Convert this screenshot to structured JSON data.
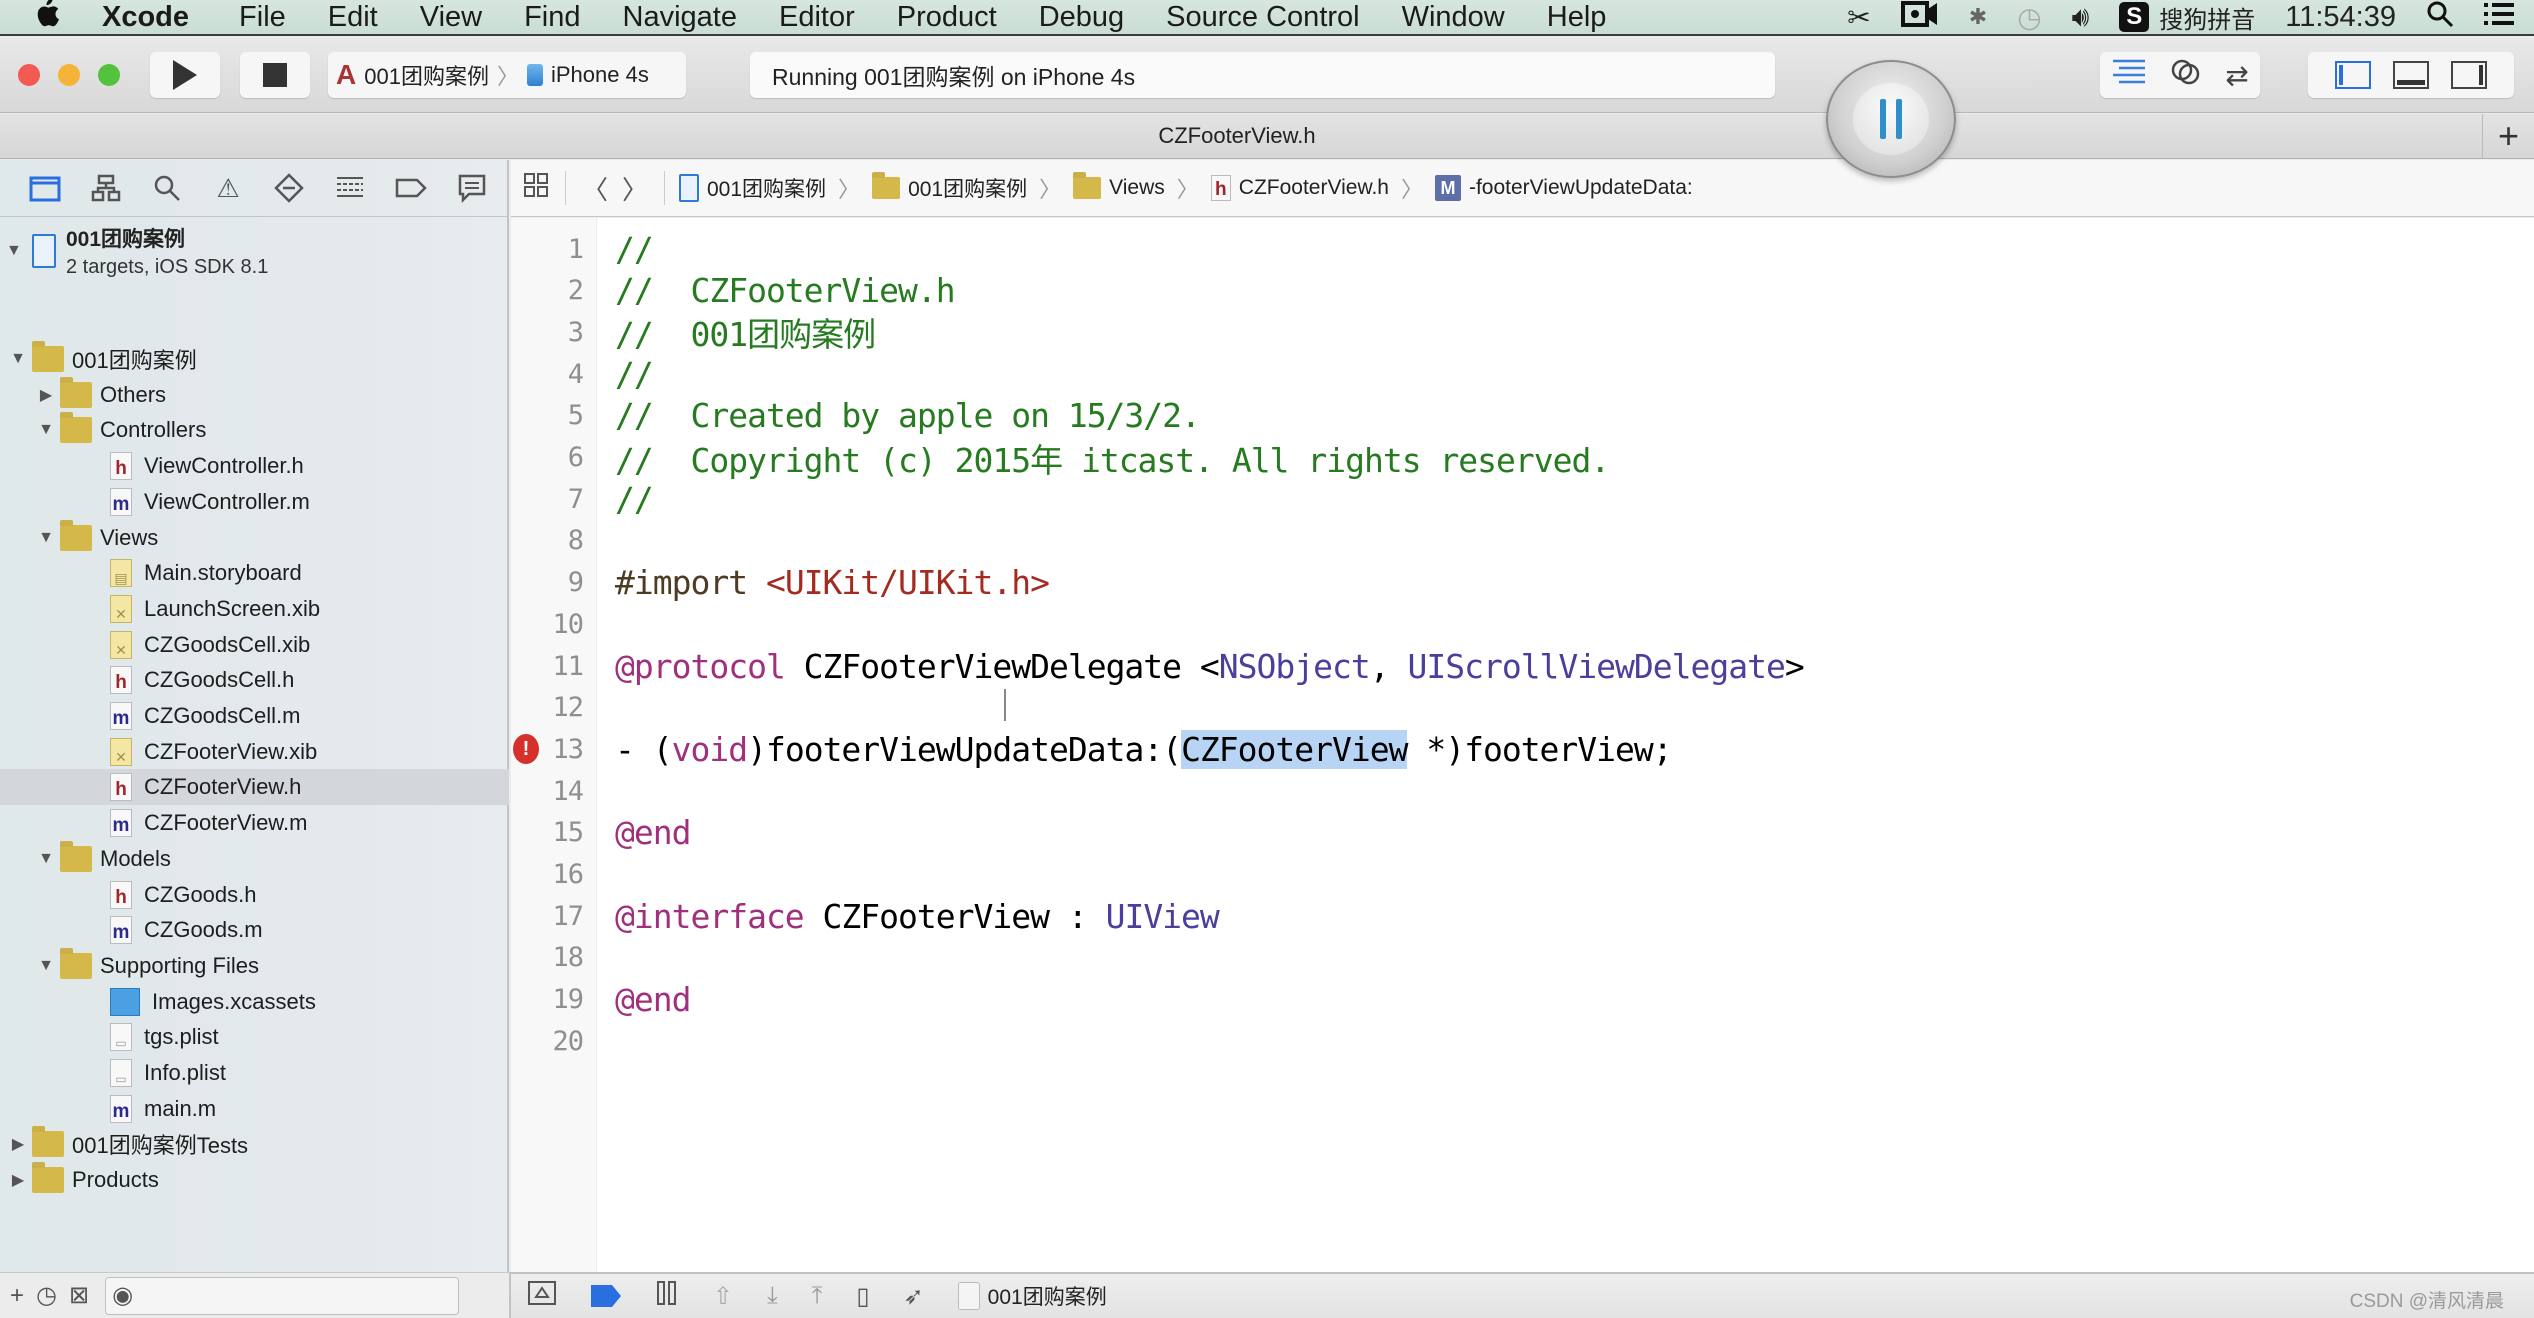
{
  "menubar": {
    "apple_icon": "apple-logo",
    "items": [
      "Xcode",
      "File",
      "Edit",
      "View",
      "Find",
      "Navigate",
      "Editor",
      "Product",
      "Debug",
      "Source Control",
      "Window",
      "Help"
    ],
    "status_icons": [
      "scissors-icon",
      "camera-icon",
      "bluetooth-icon",
      "time-machine-icon",
      "volume-icon"
    ],
    "input_method_badge": "S",
    "input_method_label": "搜狗拼音",
    "clock": "11:54:39",
    "spotlight_icon": "search-icon",
    "notifications_icon": "list-icon"
  },
  "toolbar": {
    "scheme": "001团购案例",
    "device": "iPhone 4s",
    "activity": "Running 001团购案例 on iPhone 4s"
  },
  "tabbar": {
    "title": "CZFooterView.h",
    "add_label": "+"
  },
  "navigator": {
    "tabs": [
      "project",
      "symbol",
      "find",
      "issue",
      "test",
      "debug",
      "breakpoint",
      "report"
    ],
    "project": {
      "name": "001团购案例",
      "subtitle": "2 targets, iOS SDK 8.1"
    },
    "tree": [
      {
        "label": "001团购案例",
        "type": "folder",
        "depth": 1,
        "disclosure": "open"
      },
      {
        "label": "Others",
        "type": "folder",
        "depth": 2,
        "disclosure": "closed"
      },
      {
        "label": "Controllers",
        "type": "folder",
        "depth": 2,
        "disclosure": "open"
      },
      {
        "label": "ViewController.h",
        "type": "h",
        "depth": 3
      },
      {
        "label": "ViewController.m",
        "type": "m",
        "depth": 3
      },
      {
        "label": "Views",
        "type": "folder",
        "depth": 2,
        "disclosure": "open"
      },
      {
        "label": "Main.storyboard",
        "type": "storyboard",
        "depth": 3
      },
      {
        "label": "LaunchScreen.xib",
        "type": "xib",
        "depth": 3
      },
      {
        "label": "CZGoodsCell.xib",
        "type": "xib",
        "depth": 3
      },
      {
        "label": "CZGoodsCell.h",
        "type": "h",
        "depth": 3
      },
      {
        "label": "CZGoodsCell.m",
        "type": "m",
        "depth": 3
      },
      {
        "label": "CZFooterView.xib",
        "type": "xib",
        "depth": 3
      },
      {
        "label": "CZFooterView.h",
        "type": "h",
        "depth": 3,
        "selected": true
      },
      {
        "label": "CZFooterView.m",
        "type": "m",
        "depth": 3
      },
      {
        "label": "Models",
        "type": "folder",
        "depth": 2,
        "disclosure": "open"
      },
      {
        "label": "CZGoods.h",
        "type": "h",
        "depth": 3
      },
      {
        "label": "CZGoods.m",
        "type": "m",
        "depth": 3
      },
      {
        "label": "Supporting Files",
        "type": "folder",
        "depth": 2,
        "disclosure": "open"
      },
      {
        "label": "Images.xcassets",
        "type": "xcassets",
        "depth": 3
      },
      {
        "label": "tgs.plist",
        "type": "plist",
        "depth": 3
      },
      {
        "label": "Info.plist",
        "type": "plist",
        "depth": 3
      },
      {
        "label": "main.m",
        "type": "m",
        "depth": 3
      },
      {
        "label": "001团购案例Tests",
        "type": "folder",
        "depth": 1,
        "disclosure": "closed"
      },
      {
        "label": "Products",
        "type": "folder",
        "depth": 1,
        "disclosure": "closed"
      }
    ],
    "bottom": {
      "add_label": "+"
    }
  },
  "jumpbar": {
    "crumbs": [
      {
        "label": "001团购案例",
        "icon": "project"
      },
      {
        "label": "001团购案例",
        "icon": "folder"
      },
      {
        "label": "Views",
        "icon": "folder"
      },
      {
        "label": "CZFooterView.h",
        "icon": "h"
      },
      {
        "label": "-footerViewUpdateData:",
        "icon": "method"
      }
    ],
    "method_badge": "M",
    "h_badge": "h"
  },
  "editor": {
    "error_line": 13,
    "error_badge": "!",
    "lines": [
      [
        {
          "t": "//",
          "c": "comment"
        }
      ],
      [
        {
          "t": "//  CZFooterView.h",
          "c": "comment"
        }
      ],
      [
        {
          "t": "//  001团购案例",
          "c": "comment"
        }
      ],
      [
        {
          "t": "//",
          "c": "comment"
        }
      ],
      [
        {
          "t": "//  Created by apple on 15/3/2.",
          "c": "comment"
        }
      ],
      [
        {
          "t": "//  Copyright (c) 2015年 itcast. All rights reserved.",
          "c": "comment"
        }
      ],
      [
        {
          "t": "//",
          "c": "comment"
        }
      ],
      [],
      [
        {
          "t": "#import ",
          "c": "pre"
        },
        {
          "t": "<UIKit/UIKit.h>",
          "c": "str"
        }
      ],
      [],
      [
        {
          "t": "@protocol",
          "c": "kw"
        },
        {
          "t": " CZFooterViewDelegate <",
          "c": "plain"
        },
        {
          "t": "NSObject",
          "c": "type"
        },
        {
          "t": ", ",
          "c": "plain"
        },
        {
          "t": "UIScrollViewDelegate",
          "c": "type"
        },
        {
          "t": ">",
          "c": "plain"
        }
      ],
      [],
      [
        {
          "t": "- (",
          "c": "plain"
        },
        {
          "t": "void",
          "c": "kw"
        },
        {
          "t": ")footerViewUpdateData:(",
          "c": "plain"
        },
        {
          "t": "CZFooterView",
          "c": "sel"
        },
        {
          "t": " *)footerView;",
          "c": "plain"
        }
      ],
      [],
      [
        {
          "t": "@end",
          "c": "kw"
        }
      ],
      [],
      [
        {
          "t": "@interface",
          "c": "kw"
        },
        {
          "t": " CZFooterView : ",
          "c": "plain"
        },
        {
          "t": "UIView",
          "c": "type"
        }
      ],
      [],
      [
        {
          "t": "@end",
          "c": "kw"
        }
      ],
      []
    ]
  },
  "debugbar": {
    "process": "001团购案例"
  },
  "watermark": "CSDN @清风清晨"
}
